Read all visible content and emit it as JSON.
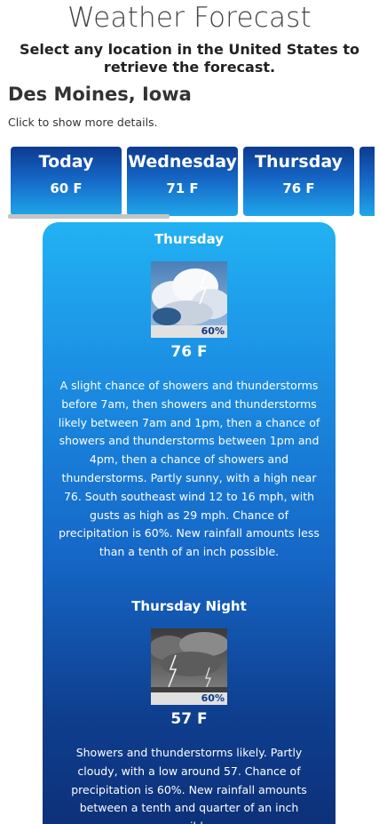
{
  "header": {
    "title": "Weather Forecast",
    "subtitle": "Select any location in the United States to retrieve the forecast."
  },
  "location": "Des Moines, Iowa",
  "hint": "Click to show more details.",
  "days": [
    {
      "name": "Today",
      "temp": "60 F"
    },
    {
      "name": "Wednesday",
      "temp": "71 F"
    },
    {
      "name": "Thursday",
      "temp": "76 F"
    }
  ],
  "detail": {
    "day_period": {
      "name": "Thursday",
      "precip": "60%",
      "temp": "76 F",
      "description": "A slight chance of showers and thunderstorms before 7am, then showers and thunderstorms likely between 7am and 1pm, then a chance of showers and thunderstorms between 1pm and 4pm, then a chance of showers and thunderstorms. Partly sunny, with a high near 76. South southeast wind 12 to 16 mph, with gusts as high as 29 mph. Chance of precipitation is 60%. New rainfall amounts less than a tenth of an inch possible."
    },
    "night_period": {
      "name": "Thursday Night",
      "precip": "60%",
      "temp": "57 F",
      "description": "Showers and thunderstorms likely. Partly cloudy, with a low around 57. Chance of precipitation is 60%. New rainfall amounts between a tenth and quarter of an inch possible."
    }
  },
  "colors": {
    "tile_top": "#0d3a8f",
    "tile_bottom": "#1fa6ea",
    "card_top": "#22b2f3",
    "card_bottom": "#0d2f77"
  }
}
